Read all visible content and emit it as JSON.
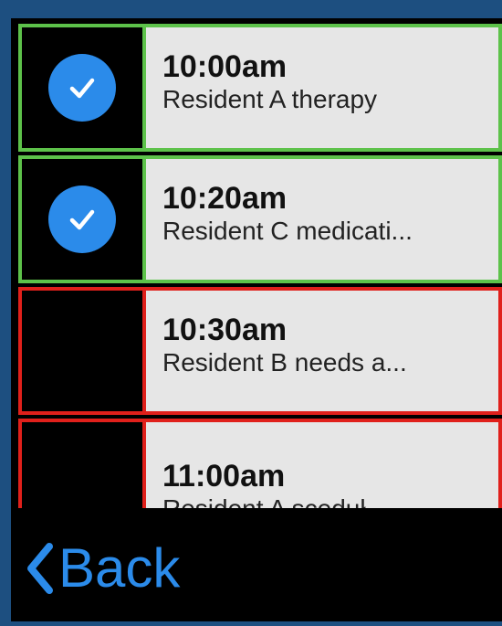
{
  "schedule": {
    "items": [
      {
        "time": "10:00am",
        "description": "Resident A therapy",
        "status": "completed"
      },
      {
        "time": "10:20am",
        "description": "Resident C medicati...",
        "status": "completed"
      },
      {
        "time": "10:30am",
        "description": "Resident B needs a...",
        "status": "pending"
      },
      {
        "time": "11:00am",
        "description": "Resident A sceduł",
        "status": "pending"
      }
    ]
  },
  "navigation": {
    "back_label": "Back",
    "back_icon": "chevron-left-icon"
  },
  "colors": {
    "completed_border": "#5dc24a",
    "pending_border": "#e0201b",
    "check_fill": "#2b8bea",
    "accent": "#2b8bea",
    "item_background": "#e6e6e6",
    "frame": "#1d4f80"
  },
  "icons": {
    "completed": "checkmark-circle-icon"
  }
}
